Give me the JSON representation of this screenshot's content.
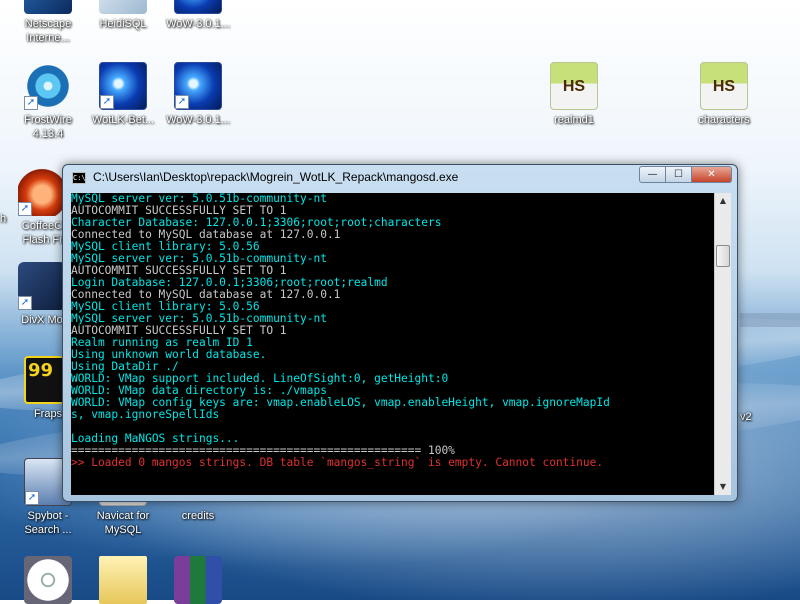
{
  "colors": {
    "console_bg": "#000000",
    "text_white": "#c8c8c8",
    "text_cyan": "#00e6e6",
    "text_red": "#e03030"
  },
  "desktop": {
    "icons": [
      {
        "name": "netscape",
        "label": "Netscape\nInterne..."
      },
      {
        "name": "heidisql",
        "label": "HeidiSQL"
      },
      {
        "name": "wow-top",
        "label": "WoW-3.0.1..."
      },
      {
        "name": "frostwire",
        "label": "FrostWire\n4.13.4"
      },
      {
        "name": "wotlk",
        "label": "WotLK-Bet..."
      },
      {
        "name": "wow",
        "label": "WoW-3.0.1..."
      },
      {
        "name": "realmd1",
        "label": "realmd1"
      },
      {
        "name": "characters",
        "label": "characters"
      },
      {
        "name": "coffeecup",
        "label": "CoffeeC\nFlash Fi"
      },
      {
        "name": "divx",
        "label": "DivX Mo"
      },
      {
        "name": "fraps",
        "label": "Fraps"
      },
      {
        "name": "spybot",
        "label": "Spybot -\nSearch ..."
      },
      {
        "name": "navicat",
        "label": "Navicat for\nMySQL"
      },
      {
        "name": "credits",
        "label": "credits"
      }
    ],
    "slivers": {
      "left_h": "h",
      "right_v2": "v2"
    },
    "hs_text": "HS",
    "fraps_number": "99"
  },
  "console_window": {
    "title": "C:\\Users\\Ian\\Desktop\\repack\\Mogrein_WotLK_Repack\\mangosd.exe",
    "controls": {
      "minimize": "—",
      "maximize": "☐",
      "close": "✕"
    },
    "lines": [
      {
        "text": "MySQL server ver: 5.0.51b-community-nt",
        "color": "cyan"
      },
      {
        "text": "AUTOCOMMIT SUCCESSFULLY SET TO 1",
        "color": "white"
      },
      {
        "text": "Character Database: 127.0.0.1;3306;root;root;characters",
        "color": "cyan"
      },
      {
        "text": "Connected to MySQL database at 127.0.0.1",
        "color": "white"
      },
      {
        "text": "MySQL client library: 5.0.56",
        "color": "cyan"
      },
      {
        "text": "MySQL server ver: 5.0.51b-community-nt",
        "color": "cyan"
      },
      {
        "text": "AUTOCOMMIT SUCCESSFULLY SET TO 1",
        "color": "white"
      },
      {
        "text": "Login Database: 127.0.0.1;3306;root;root;realmd",
        "color": "cyan"
      },
      {
        "text": "Connected to MySQL database at 127.0.0.1",
        "color": "white"
      },
      {
        "text": "MySQL client library: 5.0.56",
        "color": "cyan"
      },
      {
        "text": "MySQL server ver: 5.0.51b-community-nt",
        "color": "cyan"
      },
      {
        "text": "AUTOCOMMIT SUCCESSFULLY SET TO 1",
        "color": "white"
      },
      {
        "text": "Realm running as realm ID 1",
        "color": "cyan"
      },
      {
        "text": "Using unknown world database.",
        "color": "cyan"
      },
      {
        "text": "Using DataDir ./",
        "color": "cyan"
      },
      {
        "text": "WORLD: VMap support included. LineOfSight:0, getHeight:0",
        "color": "cyan"
      },
      {
        "text": "WORLD: VMap data directory is: ./vmaps",
        "color": "cyan"
      },
      {
        "text": "WORLD: VMap config keys are: vmap.enableLOS, vmap.enableHeight, vmap.ignoreMapId",
        "color": "cyan"
      },
      {
        "text": "s, vmap.ignoreSpellIds",
        "color": "cyan"
      },
      {
        "text": "",
        "color": "white"
      },
      {
        "text": "Loading MaNGOS strings...",
        "color": "cyan"
      },
      {
        "text": "==================================================== 100%",
        "color": "white"
      },
      {
        "text": ">> Loaded 0 mangos strings. DB table `mangos_string` is empty. Cannot continue.",
        "color": "red"
      }
    ],
    "scrollbar": {
      "up": "▲",
      "down": "▼"
    }
  }
}
